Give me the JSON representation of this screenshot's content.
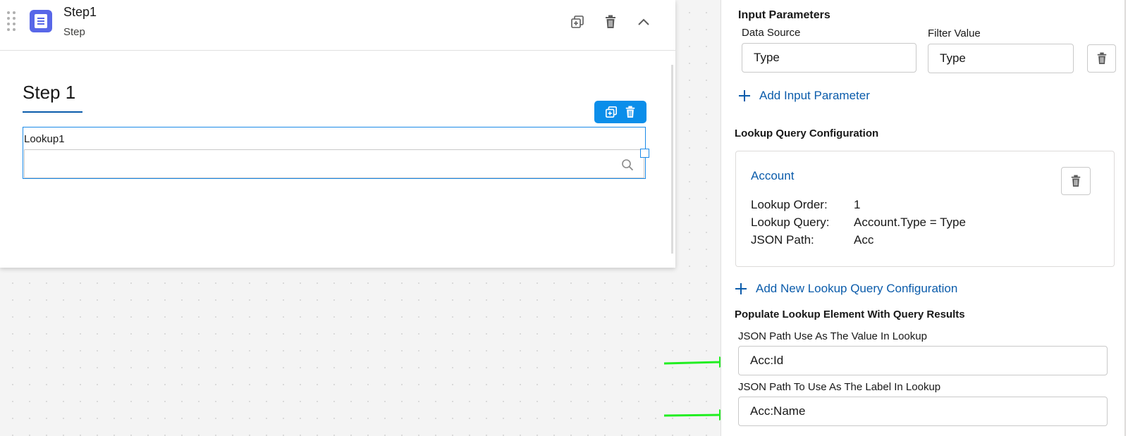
{
  "canvas": {
    "step_card": {
      "title": "Step1",
      "subtitle": "Step",
      "heading": "Step 1",
      "lookup": {
        "label": "Lookup1",
        "value": ""
      }
    }
  },
  "panel": {
    "input_parameters": {
      "title": "Input Parameters",
      "data_source_label": "Data Source",
      "filter_value_label": "Filter Value",
      "data_source_value": "Type",
      "filter_value_value": "Type",
      "add_label": "Add Input Parameter"
    },
    "lookup_query_configuration": {
      "title": "Lookup Query Configuration",
      "object_name": "Account",
      "rows": [
        {
          "key": "Lookup Order:",
          "value": "1"
        },
        {
          "key": "Lookup Query:",
          "value": "Account.Type = Type"
        },
        {
          "key": "JSON Path:",
          "value": "Acc"
        }
      ],
      "add_label": "Add New Lookup Query Configuration"
    },
    "populate": {
      "title": "Populate Lookup Element With Query Results",
      "value_path_label": "JSON Path Use As The Value In Lookup",
      "value_path_value": "Acc:Id",
      "label_path_label": "JSON Path To Use As The Label In Lookup",
      "label_path_value": "Acc:Name"
    }
  },
  "colors": {
    "accent_blue": "#0b5cab",
    "toolbar_blue": "#0b8eea",
    "step_badge": "#5867e8",
    "annotation_arrow": "#22ee22"
  }
}
